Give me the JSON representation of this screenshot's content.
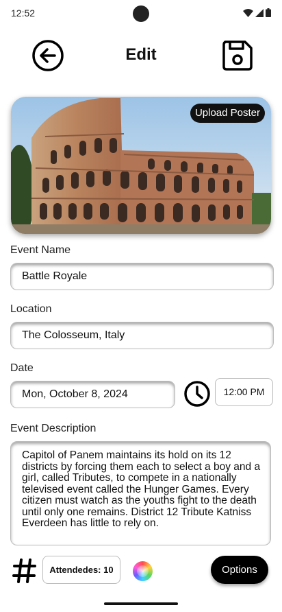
{
  "status_bar": {
    "time": "12:52"
  },
  "header": {
    "title": "Edit",
    "back_icon": "arrow-left-circle-icon",
    "save_icon": "floppy-disk-icon"
  },
  "poster": {
    "upload_label": "Upload Poster",
    "image_subject": "Colosseum"
  },
  "form": {
    "event_name": {
      "label": "Event Name",
      "value": "Battle Royale"
    },
    "location": {
      "label": "Location",
      "value": "The Colosseum, Italy"
    },
    "date": {
      "label": "Date",
      "value": "Mon, October 8, 2024"
    },
    "time": {
      "value": "12:00 PM",
      "icon": "clock-icon"
    },
    "description": {
      "label": "Event Description",
      "value": "Capitol of Panem maintains its hold on its 12 districts by forcing them each to select a boy and a girl, called Tributes, to compete in a nationally televised event called the Hunger Games. Every citizen must watch as the youths fight to the death until only one remains. District 12 Tribute Katniss Everdeen has little to rely on."
    }
  },
  "bottom_bar": {
    "hash_icon": "hashtag-icon",
    "attendees": "Attendedes: 10",
    "color_icon": "color-wheel-icon",
    "options_label": "Options"
  },
  "colors": {
    "accent": "#000000",
    "text": "#111111",
    "field_border": "#bbbbbb"
  }
}
